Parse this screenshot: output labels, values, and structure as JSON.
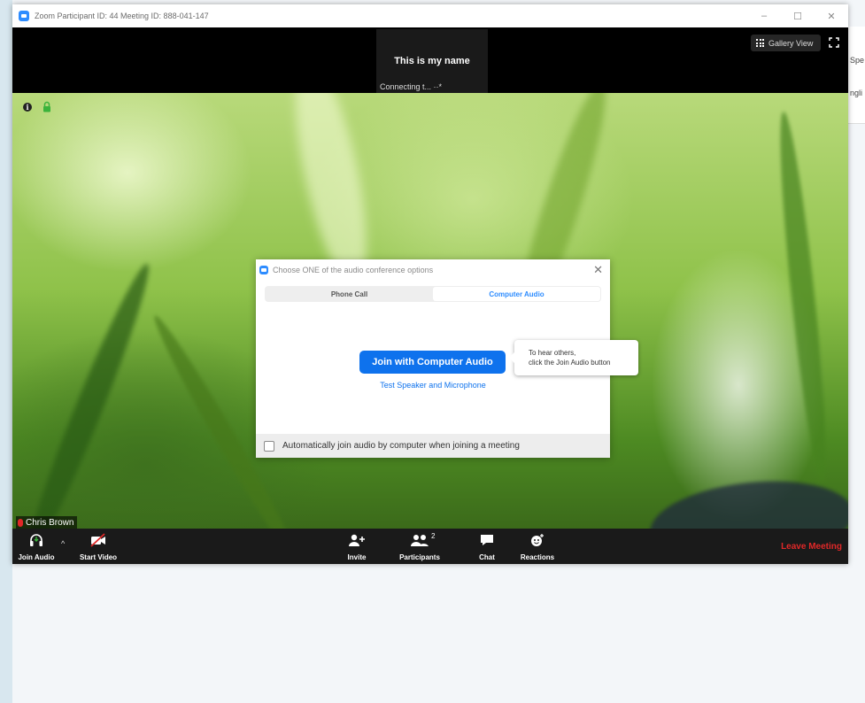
{
  "window": {
    "title": "Zoom Participant ID: 44   Meeting ID: 888-041-147",
    "controls": {
      "minimize": "–",
      "maximize": "☐",
      "close": "✕"
    }
  },
  "desktop": {
    "right_edge_text_1": "Spe",
    "right_edge_text_2": "ngli"
  },
  "topbar": {
    "participant_name": "This is my name",
    "connecting": "Connecting t...  ··*",
    "gallery_view": "Gallery View"
  },
  "video": {
    "name_label": "Chris Brown"
  },
  "toolbar": {
    "join_audio": "Join Audio",
    "start_video": "Start Video",
    "invite": "Invite",
    "participants": "Participants",
    "participants_count": "2",
    "chat": "Chat",
    "reactions": "Reactions",
    "leave_meeting": "Leave Meeting"
  },
  "dialog": {
    "title": "Choose ONE of the audio conference options",
    "close": "✕",
    "tabs": [
      {
        "label": "Phone Call",
        "selected": false
      },
      {
        "label": "Computer Audio",
        "selected": true
      }
    ],
    "join_button": "Join with Computer Audio",
    "test_link": "Test Speaker and Microphone",
    "auto_join_label": "Automatically join audio by computer when joining a meeting",
    "auto_join_checked": false
  },
  "tooltip": {
    "line1": "To hear others,",
    "line2": "click the Join Audio button"
  },
  "colors": {
    "accent": "#0e72ed",
    "leave": "#e02828",
    "toolbar_bg": "#1a1a1a"
  }
}
